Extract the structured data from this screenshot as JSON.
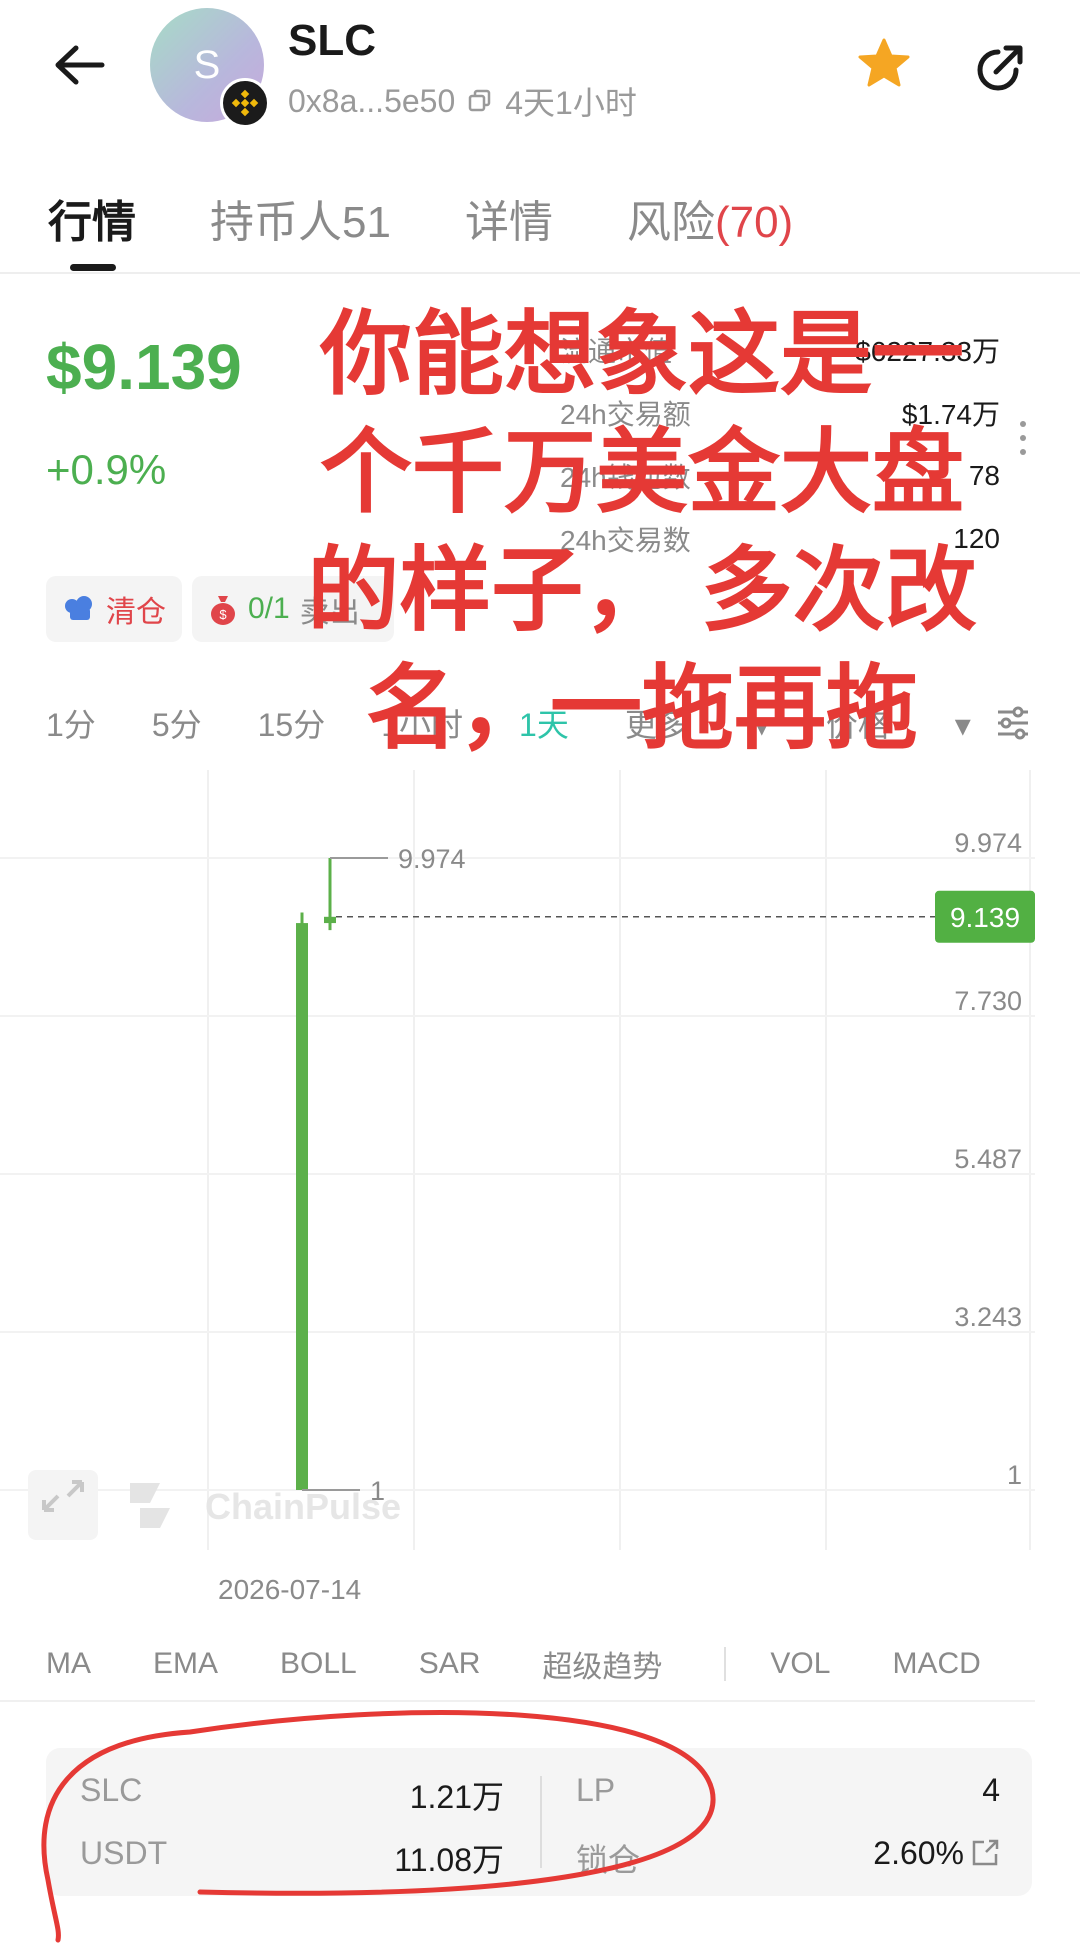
{
  "header": {
    "token_name": "SLC",
    "avatar_letter": "S",
    "address": "0x8a...5e50",
    "age": "4天1小时"
  },
  "tabs": {
    "market": "行情",
    "holders": "持币人51",
    "details": "详情",
    "risk_label": "风险",
    "risk_count": "(70)"
  },
  "price": {
    "value": "$9.139",
    "change": "+0.9%"
  },
  "stats": {
    "market_cap_label": "流通市值",
    "market_cap_value": "$6227.33万",
    "volume_label": "24h交易额",
    "volume_value": "$1.74万",
    "wallets_label": "24h钱包数",
    "wallets_value": "78",
    "txns_label": "24h交易数",
    "txns_value": "120"
  },
  "pills": {
    "clear_label": "清仓",
    "sell_value": "0/1",
    "sell_label": "卖出"
  },
  "intervals": [
    "1分",
    "5分",
    "15分",
    "1小时",
    "1天",
    "更多",
    "价格"
  ],
  "active_interval": "1天",
  "chart_data": {
    "type": "candlestick",
    "y_ticks": [
      "9.974",
      "7.730",
      "5.487",
      "3.243",
      "1"
    ],
    "ylim": [
      1,
      9.974
    ],
    "x_label": "2026-07-14",
    "candles": [
      {
        "open": 1,
        "high": 9.2,
        "low": 1,
        "close": 9.05
      },
      {
        "open": 9.05,
        "high": 9.974,
        "low": 8.95,
        "close": 9.139
      }
    ],
    "high_marker": "9.974",
    "low_marker": "1",
    "current_price": "9.139",
    "colors": {
      "up": "#5cb04a",
      "current_tag": "#52b043"
    }
  },
  "watermark": "ChainPulse",
  "indicators": [
    "MA",
    "EMA",
    "BOLL",
    "SAR",
    "超级趋势",
    "VOL",
    "MACD"
  ],
  "liquidity": {
    "token_label": "SLC",
    "token_value": "1.21万",
    "quote_label": "USDT",
    "quote_value": "11.08万",
    "lp_label": "LP",
    "lp_value": "4",
    "lock_label": "锁仓",
    "lock_value": "2.60%"
  },
  "annotation": {
    "line1": "你能想象这是一",
    "line2": "个千万美金大盘",
    "line3": "的样子， 多次改",
    "line4": "名，一拖再拖"
  }
}
